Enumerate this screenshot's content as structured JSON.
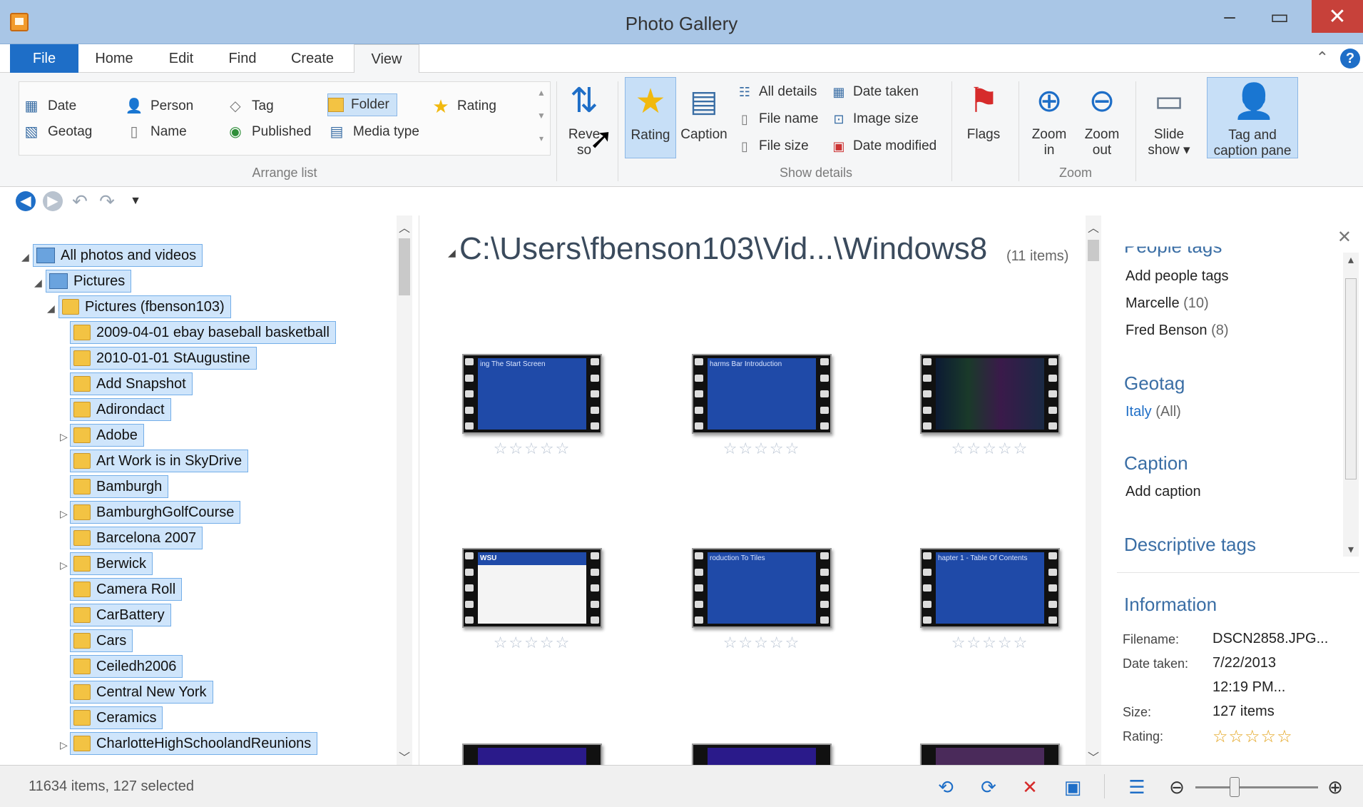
{
  "window": {
    "title": "Photo Gallery",
    "minimize": "–",
    "maximize": "▭",
    "close": "✕"
  },
  "tabs": [
    "File",
    "Home",
    "Edit",
    "Find",
    "Create",
    "View"
  ],
  "ribbon": {
    "arrange": {
      "items": [
        {
          "label": "Date",
          "icon": "calendar-icon"
        },
        {
          "label": "Person",
          "icon": "person-icon"
        },
        {
          "label": "Tag",
          "icon": "tag-icon"
        },
        {
          "label": "Folder",
          "icon": "folder-icon",
          "selected": true
        },
        {
          "label": "Rating",
          "icon": "star-icon"
        },
        {
          "label": "Geotag",
          "icon": "map-icon"
        },
        {
          "label": "Name",
          "icon": "page-icon"
        },
        {
          "label": "Published",
          "icon": "globe-icon"
        },
        {
          "label": "Media type",
          "icon": "media-icon"
        }
      ],
      "group_label": "Arrange list"
    },
    "reverse_sort": {
      "line1": "Reve",
      "line2": "so"
    },
    "rating": "Rating",
    "caption": "Caption",
    "details": {
      "all_details": "All details",
      "date_taken": "Date taken",
      "file_name": "File name",
      "image_size": "Image size",
      "file_size": "File size",
      "date_modified": "Date modified",
      "group_label": "Show details"
    },
    "flags": "Flags",
    "zoom_in": {
      "line1": "Zoom",
      "line2": "in"
    },
    "zoom_out": {
      "line1": "Zoom",
      "line2": "out"
    },
    "zoom_group": "Zoom",
    "slide_show": {
      "line1": "Slide",
      "line2": "show ▾"
    },
    "tag_caption": {
      "line1": "Tag and",
      "line2": "caption pane"
    }
  },
  "tree": {
    "root": "All photos and videos",
    "pictures": "Pictures",
    "user_pictures": "Pictures (fbenson103)",
    "folders": [
      {
        "label": "2009-04-01 ebay baseball basketball"
      },
      {
        "label": "2010-01-01 StAugustine"
      },
      {
        "label": "Add Snapshot"
      },
      {
        "label": "Adirondact"
      },
      {
        "label": "Adobe",
        "expandable": true
      },
      {
        "label": "Art Work is in SkyDrive"
      },
      {
        "label": "Bamburgh"
      },
      {
        "label": "BamburghGolfCourse",
        "expandable": true
      },
      {
        "label": "Barcelona 2007"
      },
      {
        "label": "Berwick",
        "expandable": true
      },
      {
        "label": "Camera Roll"
      },
      {
        "label": "CarBattery"
      },
      {
        "label": "Cars"
      },
      {
        "label": "Ceiledh2006"
      },
      {
        "label": "Central New York"
      },
      {
        "label": "Ceramics"
      },
      {
        "label": "CharlotteHighSchoolandReunions",
        "expandable": true
      }
    ]
  },
  "center": {
    "path": "C:\\Users\\fbenson103\\Vid...\\Windows8",
    "count": "(11 items)",
    "stars": "☆☆☆☆☆",
    "thumbs": [
      {
        "caption": "ing The Start Screen",
        "kind": "blue"
      },
      {
        "caption": "harms Bar Introduction",
        "kind": "blue"
      },
      {
        "caption": "",
        "kind": "dark"
      },
      {
        "caption": "WSU",
        "kind": "doc"
      },
      {
        "caption": "roduction To Tiles",
        "kind": "blue"
      },
      {
        "caption": "hapter 1 - Table Of Contents",
        "kind": "blue"
      }
    ]
  },
  "right_pane": {
    "people_heading": "People tags",
    "add_people": "Add people tags",
    "people": [
      {
        "name": "Marcelle",
        "count": "(10)"
      },
      {
        "name": "Fred Benson",
        "count": "(8)"
      }
    ],
    "geotag_heading": "Geotag",
    "geotag_value": "Italy",
    "geotag_all": "(All)",
    "caption_heading": "Caption",
    "add_caption": "Add caption",
    "descriptive_heading": "Descriptive tags",
    "info_heading": "Information",
    "info": {
      "filename_label": "Filename:",
      "filename": "DSCN2858.JPG...",
      "date_label": "Date taken:",
      "date": "7/22/2013",
      "time": "12:19 PM...",
      "size_label": "Size:",
      "size": "127 items",
      "rating_label": "Rating:",
      "rating": "☆☆☆☆☆"
    }
  },
  "status": {
    "text": "11634 items, 127 selected"
  },
  "colors": {
    "accent": "#1e6ec7",
    "selection": "#cfe5fb",
    "title_bar": "#a9c6e6",
    "close": "#c7413a"
  }
}
